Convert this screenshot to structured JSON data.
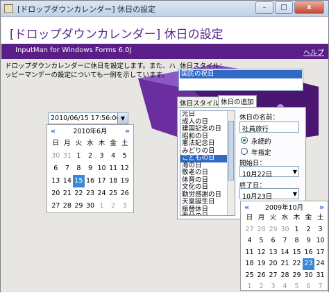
{
  "window": {
    "title": "[ドロップダウンカレンダー] 休日の設定",
    "minimize": "–",
    "maximize": "□",
    "close": "x"
  },
  "header": {
    "title": "[ドロップダウンカレンダー] 休日の設定",
    "product": "InputMan for Windows Forms 6.0J",
    "help": "ヘルプ"
  },
  "description": "ドロップダウンカレンダーに休日を設定します。また、ハッピーマンデーの設定についても一例を示しています。",
  "date_field": {
    "value": "2010/06/15 17:56:06"
  },
  "calendar_left": {
    "month": "2010年6月",
    "prev": "«",
    "next": "»",
    "weekdays": [
      "日",
      "月",
      "火",
      "水",
      "木",
      "金",
      "土"
    ],
    "days": [
      "30",
      "31",
      "1",
      "2",
      "3",
      "4",
      "5",
      "6",
      "7",
      "8",
      "9",
      "10",
      "11",
      "12",
      "13",
      "14",
      "15",
      "16",
      "17",
      "18",
      "19",
      "20",
      "21",
      "22",
      "23",
      "24",
      "25",
      "26",
      "27",
      "28",
      "29",
      "30",
      "1",
      "2",
      "3"
    ],
    "selected": "15"
  },
  "holiday_style": {
    "label": "休日スタイル：",
    "item": "国民の祝日"
  },
  "tabs": {
    "style": "休日スタイル",
    "add": "休日の追加"
  },
  "holidays": [
    "元日",
    "成人の日",
    "建国記念の日",
    "昭和の日",
    "憲法記念日",
    "みどりの日",
    "こどもの日",
    "海の日",
    "敬老の日",
    "体育の日",
    "文化の日",
    "勤労感謝の日",
    "天皇誕生日",
    "振替休日",
    "春分の日"
  ],
  "holiday_selected": "こどもの日",
  "form": {
    "name_label": "休日の名前：",
    "name_value": "社員旅行",
    "permanent": "永続的",
    "year_spec": "年指定",
    "start_label": "開始日：",
    "start_value": "10月22日",
    "end_label": "終了日：",
    "end_value": "10月23日"
  },
  "calendar_right": {
    "month": "2009年10月",
    "prev": "«",
    "next": "»",
    "weekdays": [
      "日",
      "月",
      "火",
      "水",
      "木",
      "金",
      "土"
    ],
    "days": [
      "27",
      "28",
      "29",
      "30",
      "1",
      "2",
      "3",
      "4",
      "5",
      "6",
      "7",
      "8",
      "9",
      "10",
      "11",
      "12",
      "13",
      "14",
      "15",
      "16",
      "17",
      "18",
      "19",
      "20",
      "21",
      "22",
      "23",
      "24",
      "25",
      "26",
      "27",
      "28",
      "29",
      "30",
      "31",
      "1",
      "2",
      "3",
      "4",
      "5",
      "6",
      "7"
    ],
    "selected": "23"
  },
  "colors": {
    "accent": "#5a1f86",
    "title_text": "#5a2a8a",
    "selection": "#316ac5",
    "calendar_selected": "#3a86d9"
  }
}
